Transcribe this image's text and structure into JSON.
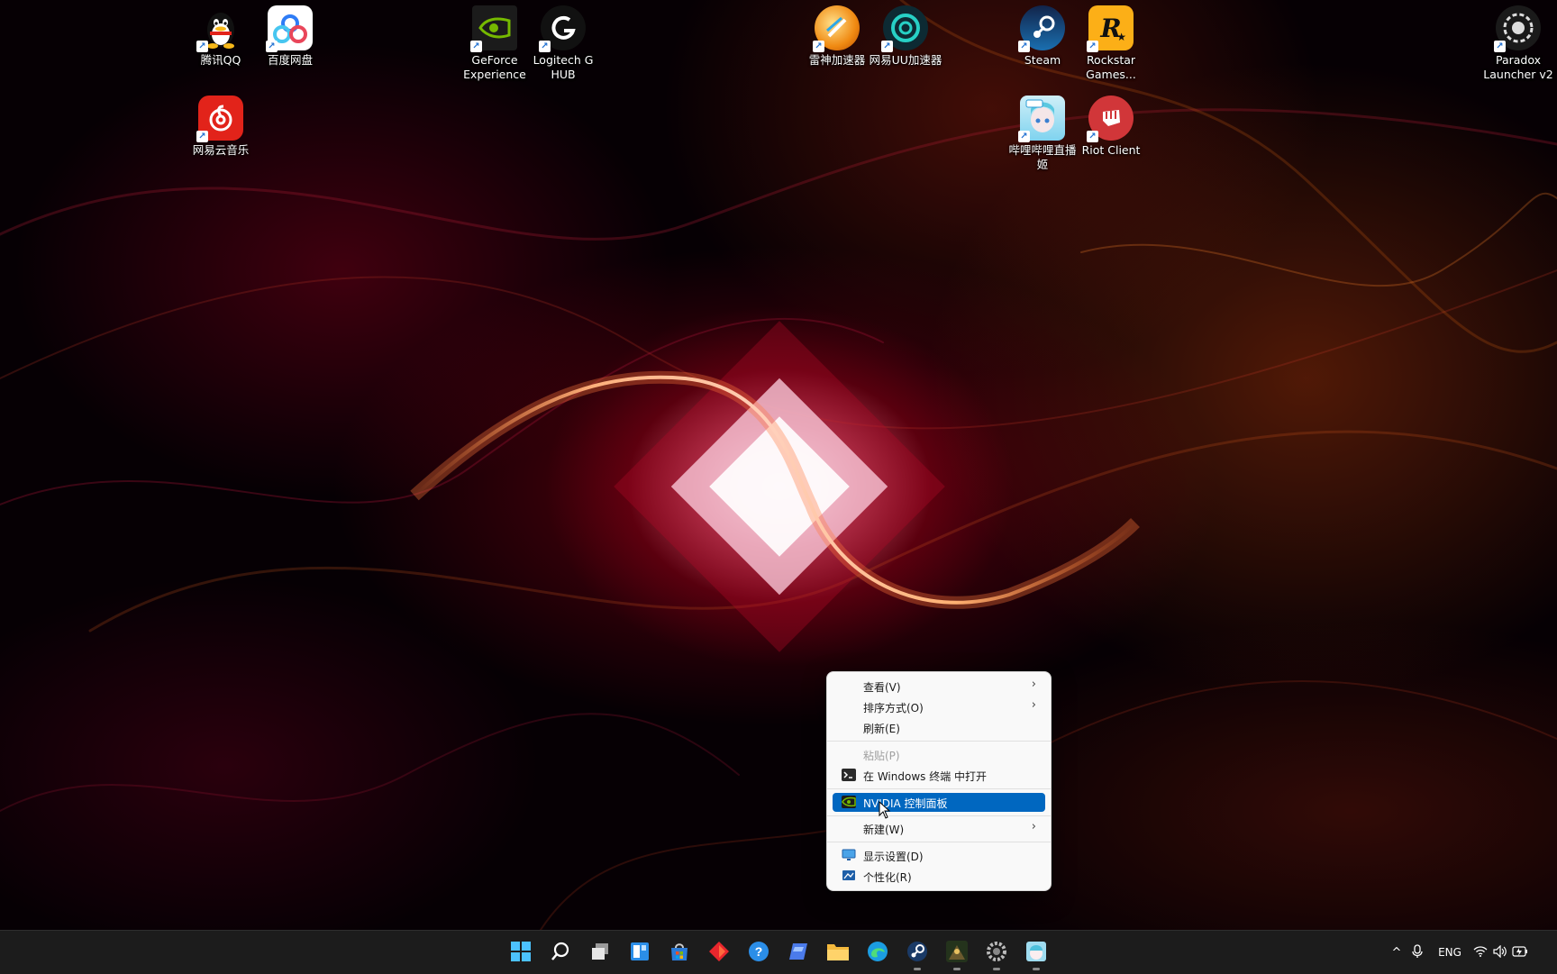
{
  "desktop": {
    "icons": [
      {
        "label": "腾讯QQ"
      },
      {
        "label": "百度网盘"
      },
      {
        "label": "网易云音乐"
      },
      {
        "label": "GeForce Experience"
      },
      {
        "label": "Logitech G HUB"
      },
      {
        "label": "雷神加速器"
      },
      {
        "label": "网易UU加速器"
      },
      {
        "label": "Steam"
      },
      {
        "label": "Rockstar Games..."
      },
      {
        "label": "哔哩哔哩直播姬"
      },
      {
        "label": "Riot Client"
      },
      {
        "label": "Paradox Launcher v2"
      }
    ]
  },
  "context_menu": {
    "items": [
      {
        "label": "查看(V)",
        "has_submenu": true
      },
      {
        "label": "排序方式(O)",
        "has_submenu": true
      },
      {
        "label": "刷新(E)"
      },
      {
        "label": "粘贴(P)",
        "disabled": true
      },
      {
        "label": "在 Windows 终端 中打开"
      },
      {
        "label": "NVIDIA 控制面板",
        "highlighted": true
      },
      {
        "label": "新建(W)",
        "has_submenu": true
      },
      {
        "label": "显示设置(D)"
      },
      {
        "label": "个性化(R)"
      }
    ]
  },
  "taskbar": {
    "apps": [
      "start",
      "search",
      "task-view",
      "widgets",
      "store",
      "app-red",
      "help",
      "app-blue",
      "file-explorer",
      "edge",
      "steam",
      "game-app",
      "settings",
      "bilibili-live"
    ],
    "tray": {
      "language": "ENG"
    }
  },
  "colors": {
    "accent": "#0067c0",
    "taskbar": "#1c1c1c",
    "menu_bg": "#f9f9f9"
  }
}
